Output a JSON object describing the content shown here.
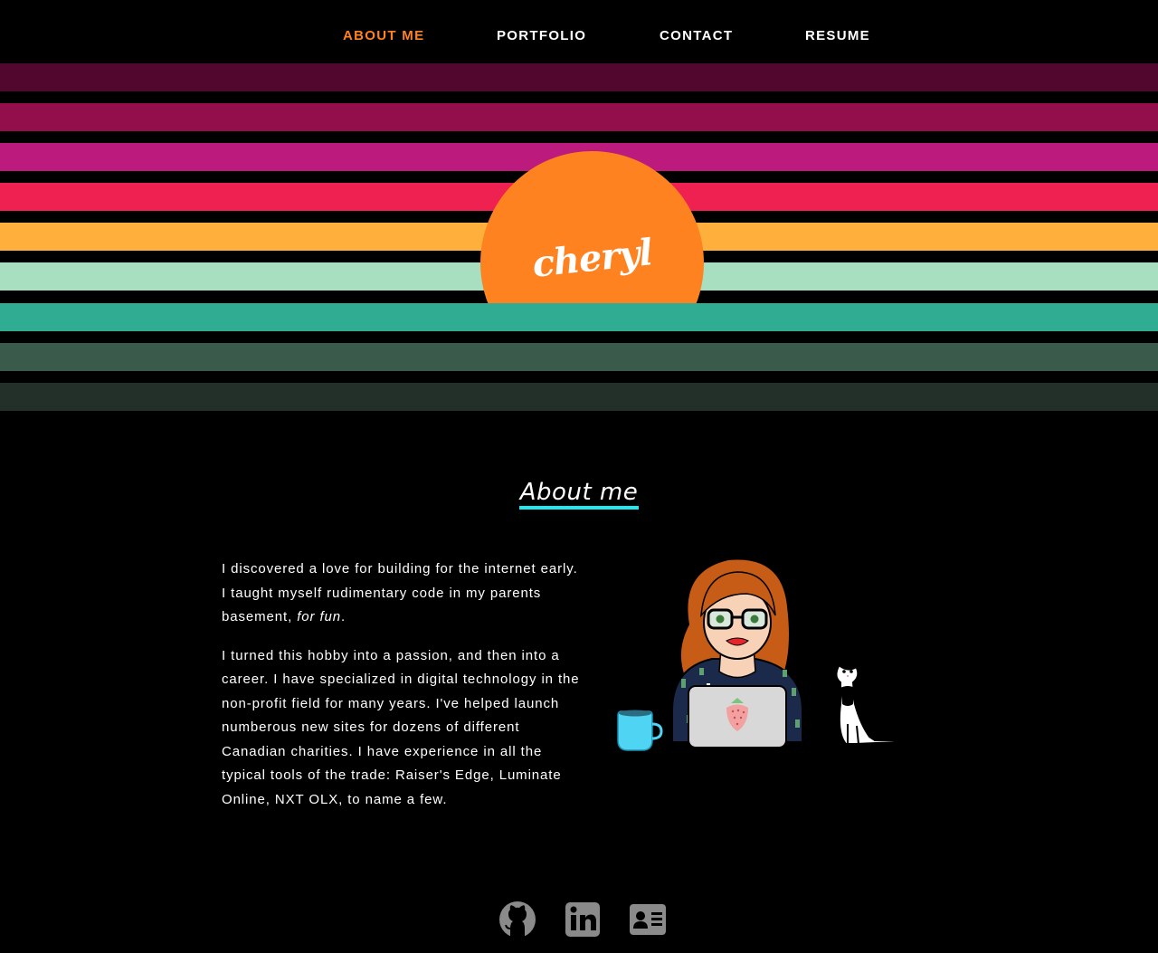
{
  "nav": {
    "items": [
      {
        "label": "ABOUT ME",
        "active": true
      },
      {
        "label": "PORTFOLIO",
        "active": false
      },
      {
        "label": "CONTACT",
        "active": false
      },
      {
        "label": "RESUME",
        "active": false
      }
    ]
  },
  "hero": {
    "name": "cheryl",
    "sun_color": "#ff8220",
    "stripe_colors": [
      "#52082e",
      "#930f4b",
      "#bd1a7e",
      "#ef2151",
      "#ffaf3c",
      "#a8dfc1",
      "#2fac91",
      "#3a5a4c",
      "#23302a"
    ]
  },
  "about": {
    "heading": "About me",
    "accent_color": "#1ee8f0",
    "para1_text": "I discovered a love for building for the internet early. I taught myself rudimentary code in my parents basement, ",
    "para1_emphasis": "for fun",
    "para1_end": ".",
    "para2": "I turned this hobby into a passion, and then into a career. I have specialized in digital technology in the non-profit field for many years. I've helped launch numberous new sites for dozens of different Canadian charities. I have experience in all the typical tools of the trade: Raiser's Edge, Luminate Online, NXT OLX, to name a few."
  },
  "footer": {
    "icons": [
      "github-icon",
      "linkedin-icon",
      "contact-card-icon"
    ]
  }
}
